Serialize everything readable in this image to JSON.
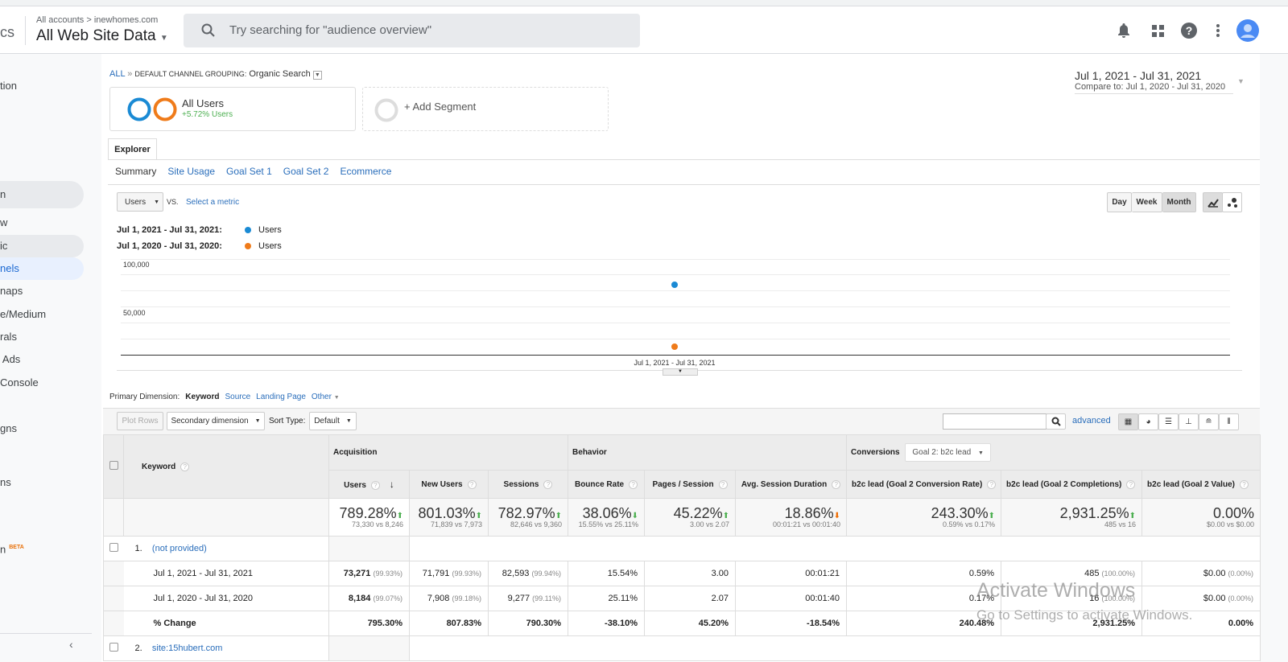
{
  "header": {
    "app_fragment": "cs",
    "breadcrumb": "All accounts > inewhomes.com",
    "view": "All Web Site Data",
    "search_placeholder": "Try searching for \"audience overview\"",
    "icons": [
      "bell-icon",
      "apps-grid-icon",
      "help-icon",
      "more-vert-icon",
      "avatar"
    ]
  },
  "sidebar": {
    "items": [
      {
        "label": "tion",
        "state": "normal"
      },
      {
        "label": "n",
        "state": "selected-gray"
      },
      {
        "label": "w",
        "state": "normal"
      },
      {
        "label": "ic",
        "state": "selected-gray"
      },
      {
        "label": "nels",
        "state": "active"
      },
      {
        "label": "naps",
        "state": "normal"
      },
      {
        "label": "e/Medium",
        "state": "normal"
      },
      {
        "label": "rals",
        "state": "normal"
      },
      {
        "label": " Ads",
        "state": "normal"
      },
      {
        "label": "Console",
        "state": "normal"
      },
      {
        "label": "gns",
        "state": "normal"
      },
      {
        "label": "ns",
        "state": "normal"
      },
      {
        "label": "n",
        "state": "normal",
        "badge": "BETA"
      }
    ]
  },
  "breadcrumb": {
    "all": "ALL",
    "sep": "»",
    "grouping": "DEFAULT CHANNEL GROUPING:",
    "value": "Organic Search"
  },
  "segment": {
    "name": "All Users",
    "delta": "+5.72% Users",
    "add": "+ Add Segment"
  },
  "date_range": {
    "main": "Jul 1, 2021 - Jul 31, 2021",
    "compare": "Compare to: Jul 1, 2020 - Jul 31, 2020"
  },
  "tabs": {
    "explorer": "Explorer",
    "subtabs": [
      "Summary",
      "Site Usage",
      "Goal Set 1",
      "Goal Set 2",
      "Ecommerce"
    ]
  },
  "chart_controls": {
    "metric": "Users",
    "vs": "VS.",
    "select_metric": "Select a metric",
    "granularity": [
      "Day",
      "Week",
      "Month"
    ],
    "selected": "Month"
  },
  "colors": {
    "current": "#1a8ad4",
    "previous": "#ef7b1a",
    "positive": "#4caf50",
    "negative": "#ef6c00",
    "link": "#2a6ebb"
  },
  "chart_data": {
    "type": "scatter",
    "legend": [
      {
        "period": "Jul 1, 2021 - Jul 31, 2021:",
        "name": "Users"
      },
      {
        "period": "Jul 1, 2020 - Jul 31, 2020:",
        "name": "Users"
      }
    ],
    "yticks": [
      "100,000",
      "50,000"
    ],
    "ylim": [
      0,
      100000
    ],
    "categories": [
      "Jul 1, 2021 - Jul 31, 2021"
    ],
    "series": [
      {
        "name": "Users",
        "values": [
          73330
        ]
      },
      {
        "name": "Users",
        "values": [
          8246
        ]
      }
    ]
  },
  "dimension": {
    "label": "Primary Dimension:",
    "options": [
      "Keyword",
      "Source",
      "Landing Page",
      "Other"
    ],
    "selected": "Keyword"
  },
  "table_controls": {
    "plot_rows": "Plot Rows",
    "secondary": "Secondary dimension",
    "sort_label": "Sort Type:",
    "sort_value": "Default",
    "search_value": "",
    "advanced": "advanced"
  },
  "table": {
    "keyword_header": "Keyword",
    "groups": {
      "acquisition": "Acquisition",
      "behavior": "Behavior",
      "conversions": "Conversions",
      "goal_select": "Goal 2: b2c lead"
    },
    "columns": [
      "Users",
      "New Users",
      "Sessions",
      "Bounce Rate",
      "Pages / Session",
      "Avg. Session Duration",
      "b2c lead (Goal 2 Conversion Rate)",
      "b2c lead (Goal 2 Completions)",
      "b2c lead (Goal 2 Value)"
    ],
    "summary": [
      {
        "value": "789.28%",
        "dir": "up",
        "sub": "73,330 vs 8,246"
      },
      {
        "value": "801.03%",
        "dir": "up",
        "sub": "71,839 vs 7,973"
      },
      {
        "value": "782.97%",
        "dir": "up",
        "sub": "82,646 vs 9,360"
      },
      {
        "value": "38.06%",
        "dir": "down-good",
        "sub": "15.55% vs 25.11%"
      },
      {
        "value": "45.22%",
        "dir": "up",
        "sub": "3.00 vs 2.07"
      },
      {
        "value": "18.86%",
        "dir": "down",
        "sub": "00:01:21 vs 00:01:40"
      },
      {
        "value": "243.30%",
        "dir": "up",
        "sub": "0.59% vs 0.17%"
      },
      {
        "value": "2,931.25%",
        "dir": "up",
        "sub": "485 vs 16"
      },
      {
        "value": "0.00%",
        "dir": "",
        "sub": "$0.00 vs $0.00"
      }
    ],
    "rows": [
      {
        "index": "1.",
        "keyword": "(not provided)",
        "sub": [
          {
            "label": "Jul 1, 2021 - Jul 31, 2021",
            "cells": [
              [
                "73,271",
                "(99.93%)"
              ],
              [
                "71,791",
                "(99.93%)"
              ],
              [
                "82,593",
                "(99.94%)"
              ],
              [
                "15.54%",
                ""
              ],
              [
                "3.00",
                ""
              ],
              [
                "00:01:21",
                ""
              ],
              [
                "0.59%",
                ""
              ],
              [
                "485",
                "(100.00%)"
              ],
              [
                "$0.00",
                "(0.00%)"
              ]
            ]
          },
          {
            "label": "Jul 1, 2020 - Jul 31, 2020",
            "cells": [
              [
                "8,184",
                "(99.07%)"
              ],
              [
                "7,908",
                "(99.18%)"
              ],
              [
                "9,277",
                "(99.11%)"
              ],
              [
                "25.11%",
                ""
              ],
              [
                "2.07",
                ""
              ],
              [
                "00:01:40",
                ""
              ],
              [
                "0.17%",
                ""
              ],
              [
                "16",
                "(100.00%)"
              ],
              [
                "$0.00",
                "(0.00%)"
              ]
            ]
          },
          {
            "label": "% Change",
            "cells": [
              [
                "795.30%",
                ""
              ],
              [
                "807.83%",
                ""
              ],
              [
                "790.30%",
                ""
              ],
              [
                "-38.10%",
                ""
              ],
              [
                "45.20%",
                ""
              ],
              [
                "-18.54%",
                ""
              ],
              [
                "240.48%",
                ""
              ],
              [
                "2,931.25%",
                ""
              ],
              [
                "0.00%",
                ""
              ]
            ]
          }
        ]
      },
      {
        "index": "2.",
        "keyword": "site:15hubert.com",
        "sub": []
      }
    ]
  },
  "watermark": {
    "title": "Activate Windows",
    "subtitle": "Go to Settings to activate Windows."
  }
}
